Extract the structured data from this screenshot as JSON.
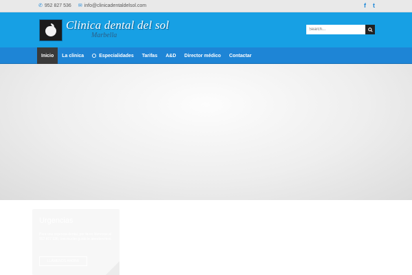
{
  "topbar": {
    "phone": "952 827 536",
    "email": "info@clinicadentaldelsol.com",
    "social": [
      {
        "icon": "facebook-icon",
        "glyph": "f"
      },
      {
        "icon": "twitter-icon",
        "glyph": "t"
      }
    ]
  },
  "brand": {
    "title": "Clinica dental del sol",
    "subtitle": "Marbella"
  },
  "search": {
    "placeholder": "Search..."
  },
  "nav": {
    "items": [
      {
        "label": "Inicio",
        "active": true
      },
      {
        "label": "La clinica"
      },
      {
        "label": "Especialidades"
      },
      {
        "label": "Tarifas"
      },
      {
        "label": "A&D"
      },
      {
        "label": "Director médico"
      },
      {
        "label": "Contactar"
      }
    ]
  },
  "urgent": {
    "title": "Urgencias",
    "text": "Para una urgencia dental, por favor llámenos al 952 827 536, con mucho gusto le atenderemos.",
    "button_label": "LLÁMENOS AHORA"
  },
  "colors": {
    "header_bg": "#17a0e4",
    "nav_bg": "#1e85d6",
    "active_nav": "#3a3a3a"
  }
}
